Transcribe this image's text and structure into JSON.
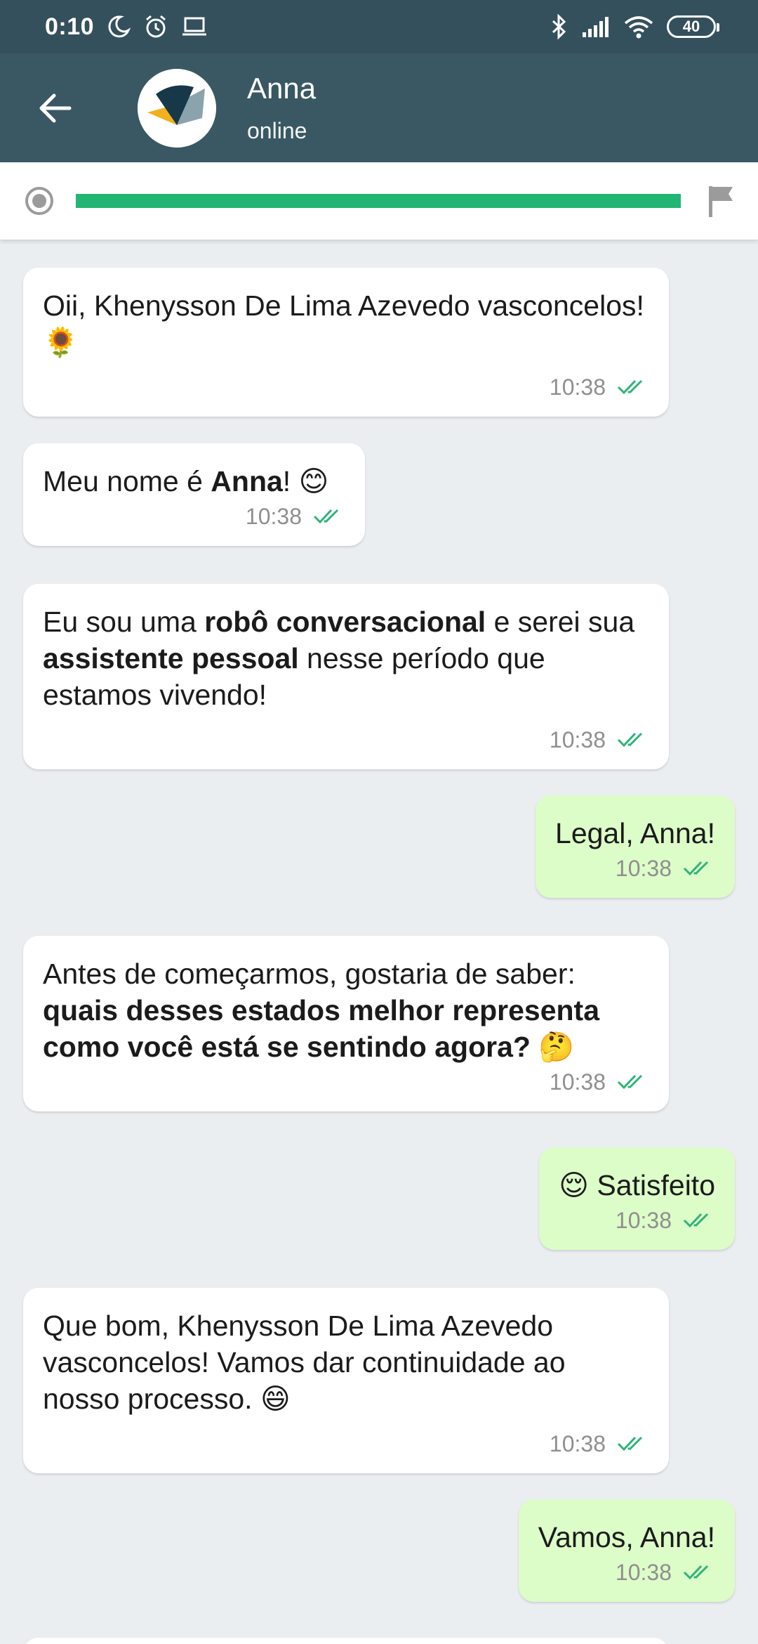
{
  "status_bar": {
    "time": "0:10",
    "battery": "40",
    "icons": [
      "moon-icon",
      "alarm-icon",
      "laptop-icon",
      "bluetooth-icon",
      "signal-icon",
      "wifi-icon",
      "battery-icon"
    ]
  },
  "header": {
    "name": "Anna",
    "status": "online",
    "back_icon": "arrow-left-icon"
  },
  "progress": {
    "value": 1.0,
    "color": "#22b573",
    "start_icon": "radio-start-icon",
    "end_icon": "flag-icon"
  },
  "messages": [
    {
      "direction": "in",
      "parts": [
        "Oii, Khenysson De Lima Azevedo vasconcelos! 🌻"
      ],
      "time": "10:38"
    },
    {
      "direction": "in",
      "parts": [
        "Meu nome é ",
        "Anna",
        "! 😊"
      ],
      "time": "10:38"
    },
    {
      "direction": "in",
      "parts": [
        "Eu sou uma ",
        "robô conversacional",
        " e serei sua ",
        "assistente pessoal",
        " nesse período que estamos vivendo!"
      ],
      "time": "10:38"
    },
    {
      "direction": "out",
      "parts": [
        "Legal, Anna!"
      ],
      "time": "10:38"
    },
    {
      "direction": "in",
      "parts": [
        "Antes de começarmos, gostaria de saber: ",
        "quais desses estados melhor representa como você está se sentindo agora? 🤔"
      ],
      "time": "10:38"
    },
    {
      "direction": "out",
      "parts": [
        "😌 Satisfeito"
      ],
      "time": "10:38"
    },
    {
      "direction": "in",
      "parts": [
        "Que bom, Khenysson De Lima Azevedo vasconcelos! Vamos dar continuidade ao nosso processo. 😄"
      ],
      "time": "10:38"
    },
    {
      "direction": "out",
      "parts": [
        "Vamos, Anna!"
      ],
      "time": "10:38"
    }
  ],
  "colors": {
    "statusbar": "#34505c",
    "header": "#3a5863",
    "chat_bg": "#ebeef1",
    "incoming": "#ffffff",
    "outgoing": "#dcfcc8",
    "read_ticks": "#2fb37a"
  }
}
